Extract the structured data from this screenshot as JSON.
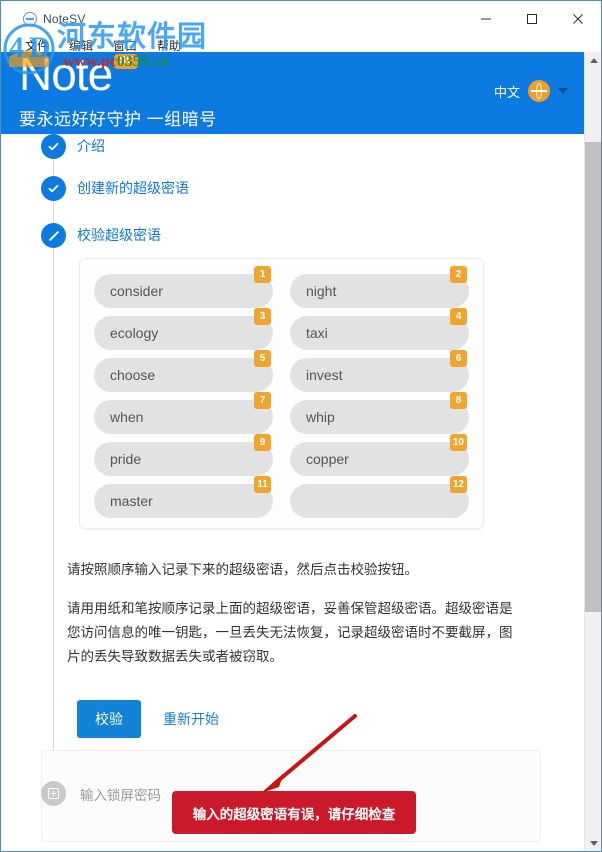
{
  "window": {
    "title": "NoteSV",
    "app_icon": "note-circle-icon",
    "controls": {
      "minimize": "minimize-icon",
      "maximize": "maximize-icon",
      "close": "close-icon"
    }
  },
  "menubar": {
    "items": [
      {
        "label": "文件"
      },
      {
        "label": "编辑"
      },
      {
        "label": "窗口"
      },
      {
        "label": "帮助"
      }
    ]
  },
  "header": {
    "logo_text": "Note",
    "logo_badge": "SV",
    "tagline": "要永远好好守护 一组暗号",
    "language": {
      "label": "中文",
      "icon": "globe-icon",
      "caret": "chevron-down-icon"
    },
    "bg_color": "#0c7ae0",
    "accent_orange": "#f0a02a"
  },
  "stepper": {
    "steps": [
      {
        "label": "介绍",
        "icon": "check-icon",
        "state": "done"
      },
      {
        "label": "创建新的超级密语",
        "icon": "check-icon",
        "state": "done"
      },
      {
        "label": "校验超级密语",
        "icon": "pencil-icon",
        "state": "current"
      }
    ]
  },
  "words": {
    "slots": [
      {
        "number": "1",
        "word": "consider"
      },
      {
        "number": "2",
        "word": "night"
      },
      {
        "number": "3",
        "word": "ecology"
      },
      {
        "number": "4",
        "word": "taxi"
      },
      {
        "number": "5",
        "word": "choose"
      },
      {
        "number": "6",
        "word": "invest"
      },
      {
        "number": "7",
        "word": "when"
      },
      {
        "number": "8",
        "word": "whip"
      },
      {
        "number": "9",
        "word": "pride"
      },
      {
        "number": "10",
        "word": "copper"
      },
      {
        "number": "11",
        "word": "master"
      },
      {
        "number": "12",
        "word": ""
      }
    ]
  },
  "body": {
    "para1": "请按照顺序输入记录下来的超级密语，然后点击校验按钮。",
    "para2": "请用用纸和笔按顺序记录上面的超级密语，妥善保管超级密语。超级密语是您访问信息的唯一钥匙，一旦丢失无法恢复，记录超级密语时不要截屏，图片的丢失导致数据丢失或者被窃取。"
  },
  "actions": {
    "verify_label": "校验",
    "restart_label": "重新开始"
  },
  "lock_step": {
    "label": "输入锁屏密码",
    "icon": "plus-square-icon"
  },
  "error": {
    "message": "输入的超级密语有误，请仔细检查",
    "color": "#c9192b",
    "arrow": "red-arrow-annotation"
  },
  "scrollbar": {
    "up": "scroll-up-arrow",
    "down": "scroll-down-arrow"
  },
  "watermark": {
    "site_name": "河东软件园",
    "url_prefix": "www.pc",
    "url_suffix": "0359.cn"
  }
}
